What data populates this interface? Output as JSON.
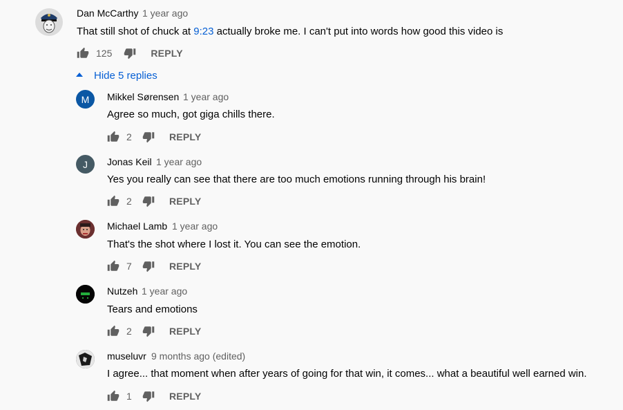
{
  "comment": {
    "author": "Dan McCarthy",
    "time": "1 year ago",
    "text_before": "That still shot of chuck at ",
    "timestamp_link": "9:23",
    "text_after": " actually broke me. I can't put into words how good this video is",
    "likes": "125",
    "reply_label": "REPLY"
  },
  "replies_toggle": {
    "label": "Hide 5 replies"
  },
  "replies": [
    {
      "initial": "M",
      "avatar_color": "#0b57a4",
      "author": "Mikkel Sørensen",
      "time": "1 year ago",
      "text": "Agree so much, got giga chills there.",
      "likes": "2",
      "reply_label": "REPLY"
    },
    {
      "initial": "J",
      "avatar_color": "#455a64",
      "author": "Jonas Keil",
      "time": "1 year ago",
      "text": "Yes you really can see that there are too much emotions running through his brain!",
      "likes": "2",
      "reply_label": "REPLY"
    },
    {
      "initial": "",
      "avatar_color": "#8a4a4a",
      "author": "Michael Lamb",
      "time": "1 year ago",
      "text": "That's the shot where I lost it. You can see the emotion.",
      "likes": "7",
      "reply_label": "REPLY"
    },
    {
      "initial": "",
      "avatar_color": "#0a0a0a",
      "author": "Nutzeh",
      "time": "1 year ago",
      "text": "Tears and emotions",
      "likes": "2",
      "reply_label": "REPLY"
    },
    {
      "initial": "",
      "avatar_color": "#1a1a1a",
      "author": "museluvr",
      "time": "9 months ago (edited)",
      "text": "I agree... that moment when after years of going for that win, it comes... what a beautiful well earned win.",
      "likes": "1",
      "reply_label": "REPLY"
    }
  ],
  "icons": {
    "like": "thumbs-up-icon",
    "dislike": "thumbs-down-icon",
    "toggle": "caret-up-icon"
  }
}
